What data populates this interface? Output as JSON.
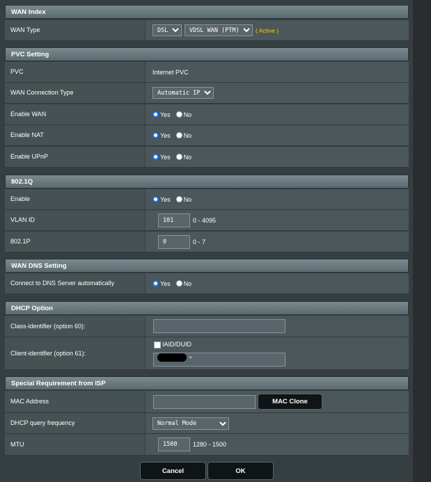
{
  "wan_index": {
    "header": "WAN Index",
    "wan_type_label": "WAN Type",
    "wan_type_select1": "DSL",
    "wan_type_select2": "VDSL WAN (PTM)",
    "active_text": "( Active )"
  },
  "pvc_setting": {
    "header": "PVC Setting",
    "pvc_label": "PVC",
    "pvc_value": "Internet PVC",
    "conn_type_label": "WAN Connection Type",
    "conn_type_value": "Automatic IP",
    "enable_wan_label": "Enable WAN",
    "enable_nat_label": "Enable NAT",
    "enable_upnp_label": "Enable UPnP"
  },
  "dot1q": {
    "header": "802.1Q",
    "enable_label": "Enable",
    "vlan_label": "VLAN ID",
    "vlan_value": "101",
    "vlan_range": "0 - 4095",
    "p_label": "802.1P",
    "p_value": "0",
    "p_range": "0 - 7"
  },
  "wan_dns": {
    "header": "WAN DNS Setting",
    "auto_label": "Connect to DNS Server automatically"
  },
  "dhcp_option": {
    "header": "DHCP Option",
    "class_label": "Class-identifier (option 60):",
    "client_label": "Client-identifier (option 61):",
    "iaid_label": "IAID/DUID",
    "client_value": "\""
  },
  "isp": {
    "header": "Special Requirement from ISP",
    "mac_label": "MAC Address",
    "mac_clone": "MAC Clone",
    "dhcp_freq_label": "DHCP query frequency",
    "dhcp_freq_value": "Normal Mode",
    "mtu_label": "MTU",
    "mtu_value": "1500",
    "mtu_range": "1280 - 1500"
  },
  "radio": {
    "yes": "Yes",
    "no": "No"
  },
  "footer": {
    "cancel": "Cancel",
    "ok": "OK"
  },
  "colors": {
    "active": "#ffcc00",
    "radio_on": "#1a73e8",
    "panel": "#353e41"
  }
}
